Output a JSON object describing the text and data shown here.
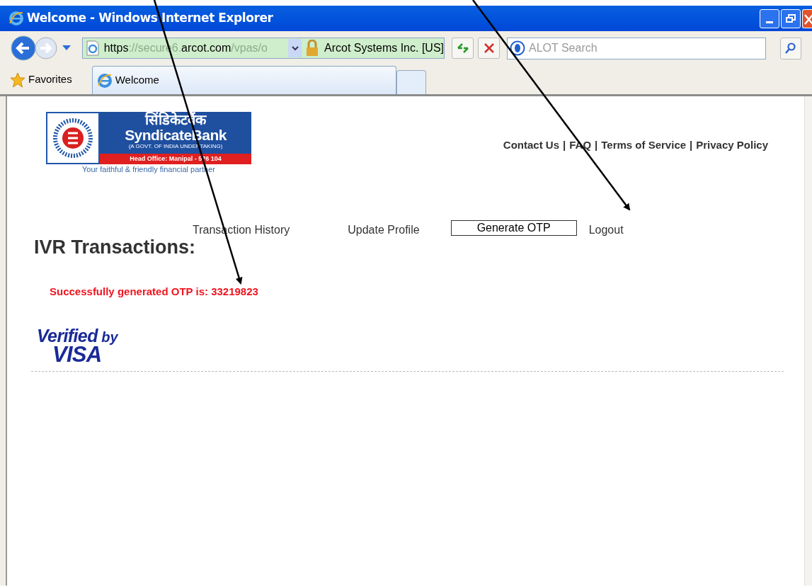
{
  "window": {
    "title": "Welcome - Windows Internet Explorer"
  },
  "address_bar": {
    "segments": [
      {
        "text": "https",
        "strong": true
      },
      {
        "text": "://secure6.",
        "strong": false
      },
      {
        "text": "arcot.com",
        "strong": true
      },
      {
        "text": "/vpas/o",
        "strong": false
      }
    ],
    "certificate": "Arcot Systems Inc. [US]"
  },
  "search": {
    "placeholder": "ALOT Search"
  },
  "favorites": {
    "label": "Favorites"
  },
  "tabs": [
    {
      "label": "Welcome",
      "selected": true
    }
  ],
  "logo": {
    "hindi": "सिंडिकेटबैंक",
    "name": "SyndicateBank",
    "subtitle": "(A GOVT. OF INDIA UNDERTAKING)",
    "office": "Head Office: Manipal - 576 104",
    "tagline": "Your faithful & friendly financial partner"
  },
  "top_links": [
    {
      "text": "Contact Us",
      "separator": "|"
    },
    {
      "text": "FAQ",
      "separator": "|"
    },
    {
      "text": "Terms of Service",
      "separator": "|"
    },
    {
      "text": "Privacy Policy"
    }
  ],
  "nav": [
    {
      "label": "Transaction History",
      "selected": false
    },
    {
      "label": "Update Profile",
      "selected": false
    },
    {
      "label": "Generate OTP",
      "selected": true
    },
    {
      "label": "Logout",
      "selected": false
    }
  ],
  "heading": "IVR Transactions:",
  "message": "Successfully generated OTP is: 33219823",
  "badge": {
    "line1": "Verified",
    "line2": "by",
    "line3": "VISA"
  }
}
